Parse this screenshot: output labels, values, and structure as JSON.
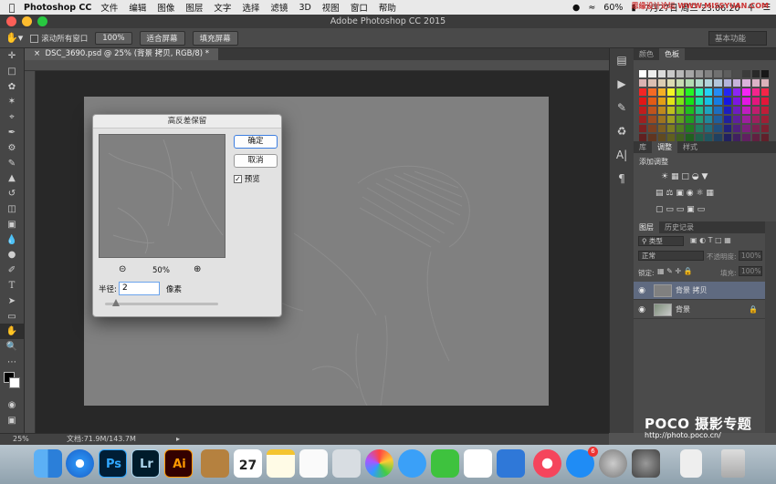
{
  "menubar": {
    "app_name": "Photoshop CC",
    "items": [
      "文件",
      "编辑",
      "图像",
      "图层",
      "文字",
      "选择",
      "滤镜",
      "3D",
      "视图",
      "窗口",
      "帮助"
    ],
    "battery": "60%",
    "datetime": "7月27日 周三  23:06:20",
    "watermark": "思缘设计论坛 WWW.MISSYUAN.COM"
  },
  "window": {
    "title": "Adobe Photoshop CC 2015"
  },
  "options": {
    "scroll_all_label": "滚动所有窗口",
    "zoom_100_label": "100%",
    "fit_screen_label": "适合屏幕",
    "fill_screen_label": "填充屏幕",
    "workspace_label": "基本功能"
  },
  "document": {
    "tab_label": "DSC_3690.psd @ 25% (背景 拷贝, RGB/8) *",
    "zoom": "25%",
    "doc_size": "文档:71.9M/143.7M"
  },
  "dialog": {
    "title": "高反差保留",
    "ok_label": "确定",
    "cancel_label": "取消",
    "preview_label": "预览",
    "preview_checked": true,
    "zoom_level": "50%",
    "radius_label": "半径:",
    "radius_value": "2",
    "unit_label": "像素",
    "slider_value": 0.1
  },
  "panels": {
    "color_tabs": [
      "颜色",
      "色板"
    ],
    "adjust_tabs": [
      "库",
      "调整",
      "样式"
    ],
    "adjust_title": "添加调整",
    "layer_tabs": [
      "图层",
      "历史记录"
    ],
    "layer_filter": "类型",
    "blend_mode": "正常",
    "opacity_label": "不透明度:",
    "opacity_value": "100%",
    "lock_label": "锁定:",
    "fill_label": "填充:",
    "fill_value": "100%",
    "layers": [
      {
        "name": "背景 拷贝",
        "selected": true
      },
      {
        "name": "背景",
        "selected": false,
        "locked": true
      }
    ]
  },
  "dock": {
    "ps_label": "Ps",
    "lr_label": "Lr",
    "ai_label": "Ai",
    "calendar_day": "27",
    "appstore_badge": "6"
  },
  "branding": {
    "logo": "POCO 摄影专题",
    "url": "http://photo.poco.cn/"
  },
  "colors": {
    "accent_blue": "#3d7ee0",
    "selected_layer": "#5f6a80",
    "canvas_gray": "#808080"
  }
}
